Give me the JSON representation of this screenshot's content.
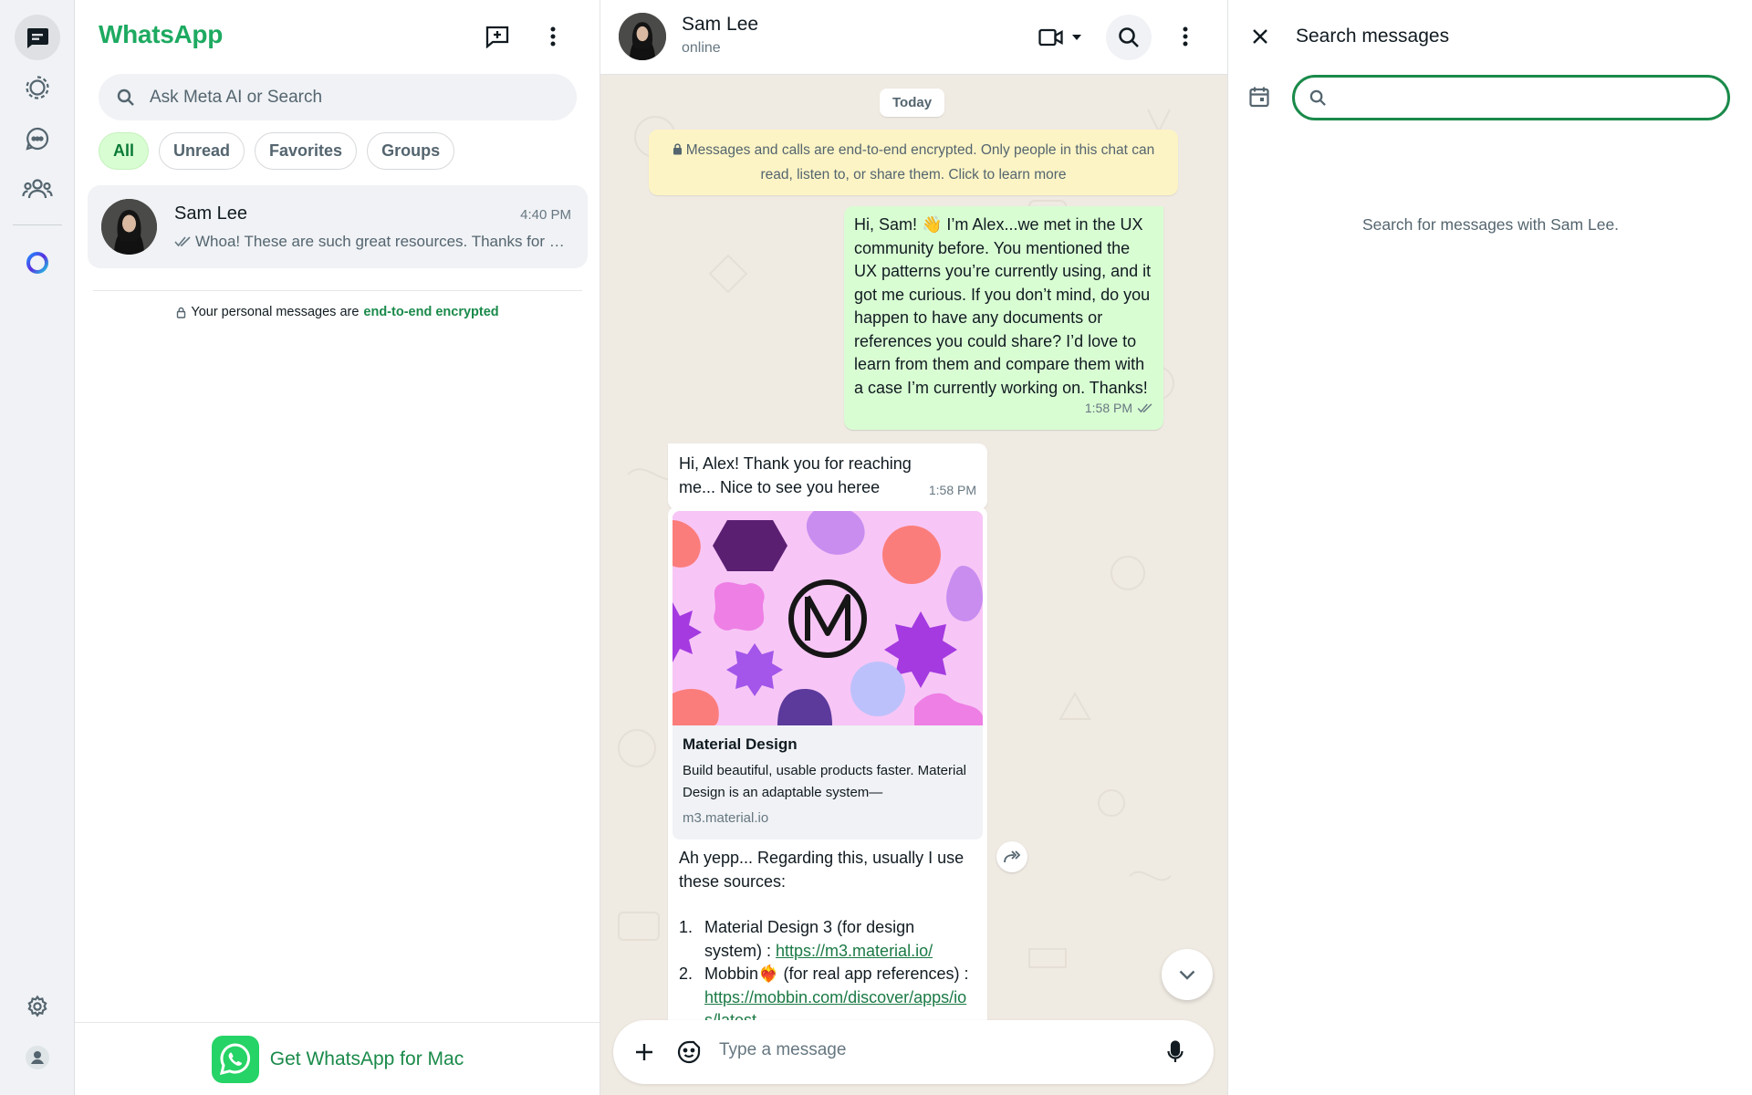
{
  "app": {
    "title": "WhatsApp",
    "accent": "#1daa61",
    "bubble_out_color": "#d9fdd3"
  },
  "rail": {
    "items": [
      {
        "icon": "chats-icon",
        "active": true
      },
      {
        "icon": "status-icon"
      },
      {
        "icon": "channels-icon"
      },
      {
        "icon": "communities-icon"
      },
      {
        "icon": "meta-ai-icon"
      }
    ],
    "bottom": [
      {
        "icon": "settings-gear-icon"
      },
      {
        "icon": "profile-icon"
      }
    ]
  },
  "chat_list": {
    "search_placeholder": "Ask Meta AI or Search",
    "filters": [
      "All",
      "Unread",
      "Favorites",
      "Groups"
    ],
    "active_filter": "All",
    "chats": [
      {
        "name": "Sam Lee",
        "time": "4:40 PM",
        "preview": "Whoa! These are such great resources. Thanks for sharing them, Sam!"
      }
    ],
    "e2e_prefix": "Your personal messages are",
    "e2e_link": "end-to-end encrypted",
    "get_app_label": "Get WhatsApp for Mac"
  },
  "conversation": {
    "contact_name": "Sam Lee",
    "contact_status": "online",
    "day_label": "Today",
    "system_message": "Messages and calls are end-to-end encrypted. Only people in this chat can read, listen to, or share them. Click to learn more",
    "messages": [
      {
        "direction": "out",
        "text": "Hi, Sam! 👋 I’m Alex...we met in the UX community before. You mentioned the UX patterns you’re currently using, and it got me curious. If you don’t mind, do you happen to have any documents or references you could share? I’d love to learn from them and compare them with a case I’m currently working on. Thanks!",
        "time": "1:58 PM"
      },
      {
        "direction": "in",
        "text": "Hi, Alex! Thank you for reaching me... Nice to see you heree",
        "time": "1:58 PM"
      },
      {
        "direction": "in",
        "link_preview": {
          "title": "Material Design",
          "description": "Build beautiful, usable products faster. Material Design is an adaptable system—",
          "domain": "m3.material.io"
        },
        "text": "Ah yepp... Regarding this, usually I use these sources:",
        "list": [
          {
            "num": "1.",
            "text": "Material Design 3 (for design system) : ",
            "link": "https://m3.material.io/"
          },
          {
            "num": "2.",
            "text": "Mobbin❤️‍🔥 (for real app references) : ",
            "link": "https://mobbin.com/discover/apps/ios/latest"
          }
        ]
      }
    ],
    "composer_placeholder": "Type a message"
  },
  "search_pane": {
    "title": "Search messages",
    "input_value": "",
    "hint": "Search for messages with Sam Lee."
  }
}
